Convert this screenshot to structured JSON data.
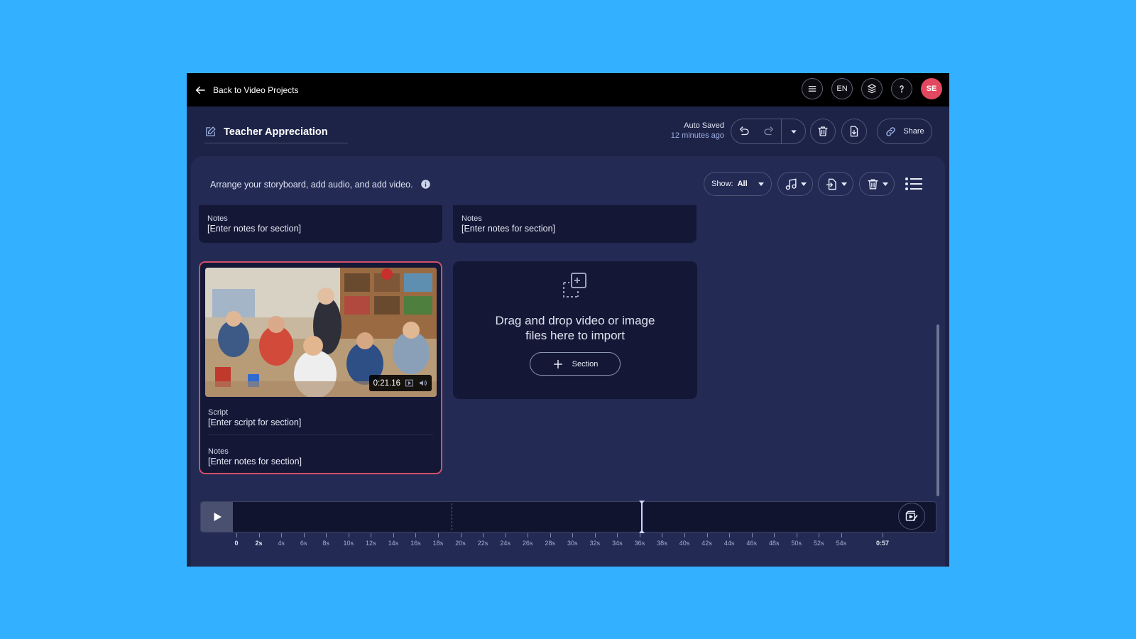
{
  "topbar": {
    "back_label": "Back to Video Projects",
    "language": "EN",
    "avatar_initials": "SE",
    "avatar_color": "#e2485f"
  },
  "project": {
    "title": "Teacher Appreciation",
    "autosave_label": "Auto Saved",
    "autosave_time": "12 minutes ago",
    "share_label": "Share"
  },
  "storyboard": {
    "instructions": "Arrange your storyboard, add audio, and add video.",
    "show_label": "Show:",
    "show_value": "All",
    "sections": [
      {
        "notes_label": "Notes",
        "notes_value": "[Enter notes for section]"
      },
      {
        "notes_label": "Notes",
        "notes_value": "[Enter notes for section]"
      }
    ],
    "clip": {
      "duration": "0:21.16",
      "script_label": "Script",
      "script_value": "[Enter script for section]",
      "notes_label": "Notes",
      "notes_value": "[Enter notes for section]"
    },
    "dropzone": {
      "text_line1": "Drag and drop video or image",
      "text_line2": "files here to import",
      "section_button": "Section"
    }
  },
  "timeline": {
    "ticks": [
      "0",
      "2s",
      "4s",
      "6s",
      "8s",
      "10s",
      "12s",
      "14s",
      "16s",
      "18s",
      "20s",
      "22s",
      "24s",
      "26s",
      "28s",
      "30s",
      "32s",
      "34s",
      "36s",
      "38s",
      "40s",
      "42s",
      "44s",
      "46s",
      "48s",
      "50s",
      "52s",
      "54s"
    ],
    "end_label": "0:57",
    "playhead_seconds": 36
  },
  "colors": {
    "background": "#33b0ff",
    "app_bg": "#1d2347",
    "panel_bg": "#232a53",
    "card_bg": "#141836",
    "selected_border": "#d05069"
  },
  "icons": [
    "back-arrow-icon",
    "menu-icon",
    "layers-icon",
    "help-icon",
    "edit-icon",
    "undo-icon",
    "redo-icon",
    "chevron-down-icon",
    "trash-icon",
    "download-icon",
    "link-icon",
    "info-icon",
    "music-icon",
    "import-icon",
    "list-icon",
    "play-icon",
    "plus-icon",
    "drop-import-icon",
    "preview-icon",
    "screen-icon",
    "volume-icon"
  ]
}
